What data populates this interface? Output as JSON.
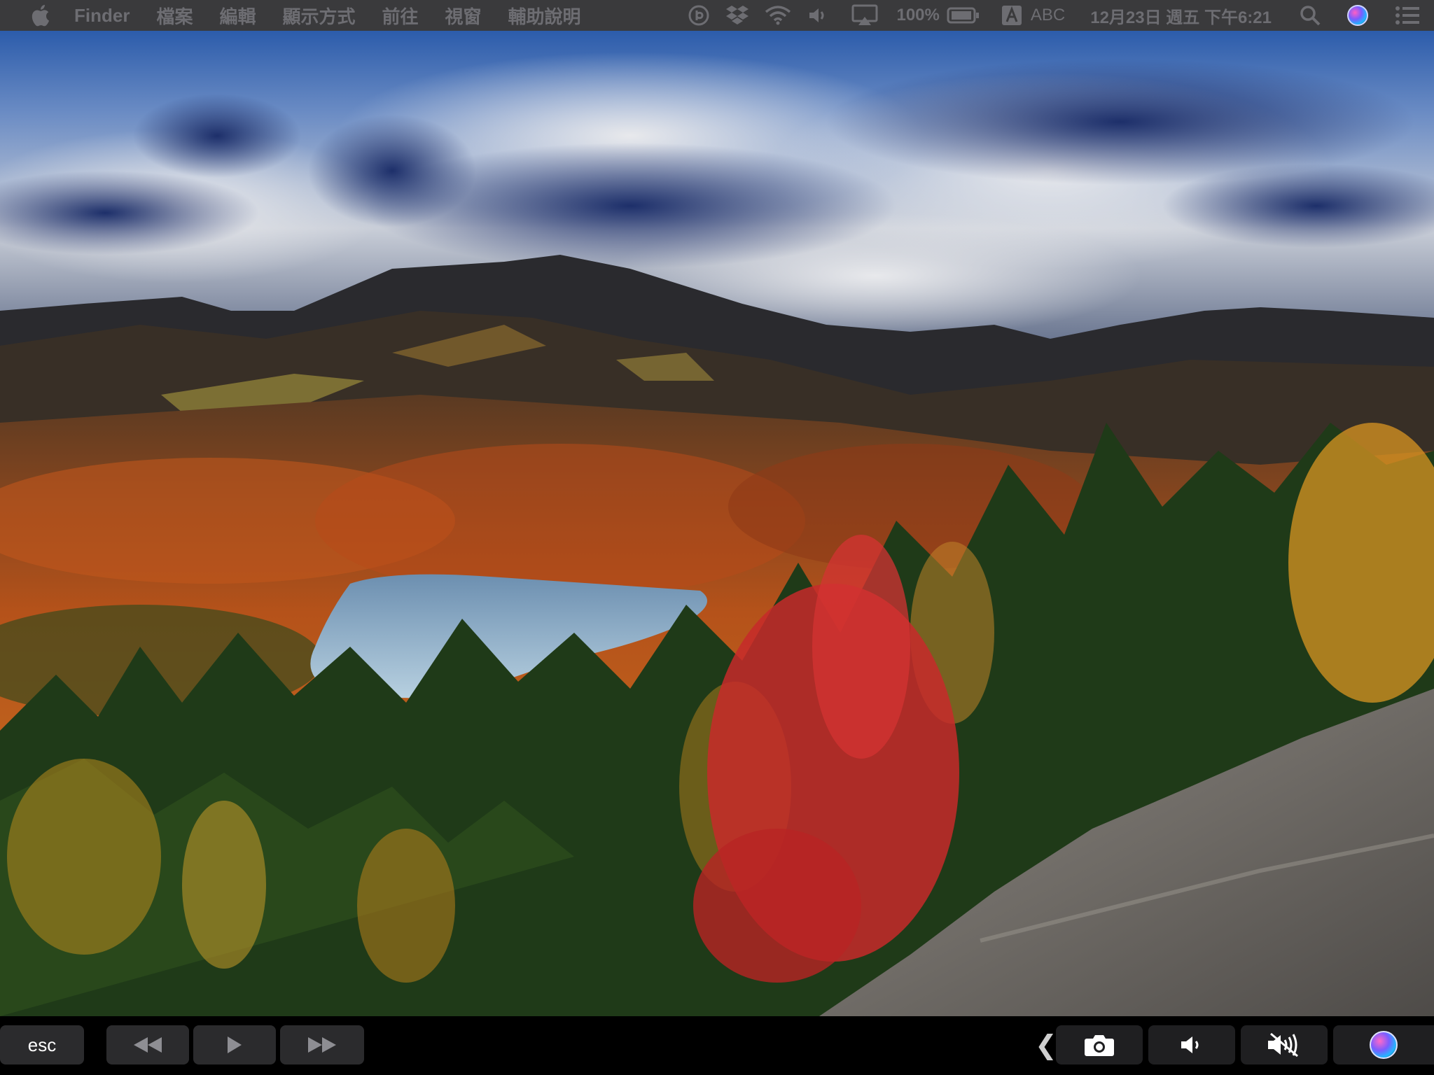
{
  "menubar": {
    "app_name": "Finder",
    "menus": [
      "檔案",
      "編輯",
      "顯示方式",
      "前往",
      "視窗",
      "輔助說明"
    ],
    "battery_percent": "100%",
    "input_method": "ABC",
    "datetime": "12月23日 週五 下午6:21"
  },
  "touchbar": {
    "esc_label": "esc",
    "back_chevron": "❮"
  }
}
